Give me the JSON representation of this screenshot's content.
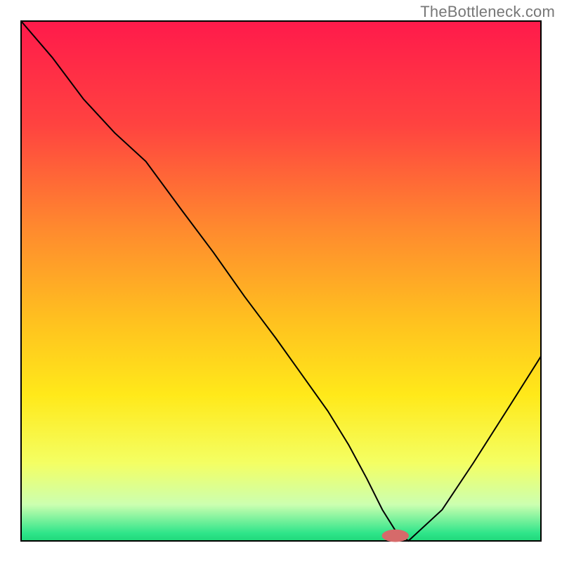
{
  "watermark": "TheBottleneck.com",
  "chart_data": {
    "type": "line",
    "title": "",
    "xlabel": "",
    "ylabel": "",
    "xlim": [
      0,
      1
    ],
    "ylim": [
      0,
      1
    ],
    "grid": false,
    "legend": false,
    "background_gradient_stops": [
      {
        "offset": 0.0,
        "color": "#ff1a4b"
      },
      {
        "offset": 0.2,
        "color": "#ff4340"
      },
      {
        "offset": 0.4,
        "color": "#ff8a2e"
      },
      {
        "offset": 0.58,
        "color": "#ffc21f"
      },
      {
        "offset": 0.72,
        "color": "#ffe91a"
      },
      {
        "offset": 0.85,
        "color": "#f4ff63"
      },
      {
        "offset": 0.93,
        "color": "#ccffb0"
      },
      {
        "offset": 0.985,
        "color": "#2fe58a"
      },
      {
        "offset": 1.0,
        "color": "#1fd87a"
      }
    ],
    "series": [
      {
        "name": "bottleneck-curve",
        "color": "#000000",
        "stroke_width": 2,
        "x": [
          0.0,
          0.06,
          0.12,
          0.18,
          0.24,
          0.31,
          0.37,
          0.43,
          0.49,
          0.54,
          0.59,
          0.63,
          0.665,
          0.695,
          0.72,
          0.745,
          0.81,
          0.87,
          0.94,
          1.0
        ],
        "y": [
          1.0,
          0.93,
          0.85,
          0.785,
          0.73,
          0.635,
          0.555,
          0.47,
          0.39,
          0.32,
          0.25,
          0.185,
          0.12,
          0.06,
          0.02,
          0.0,
          0.06,
          0.15,
          0.26,
          0.355
        ]
      }
    ],
    "flat_segment": {
      "x0": 0.695,
      "x1": 0.745,
      "y": 0.0
    },
    "marker": {
      "x": 0.72,
      "y": 0.01,
      "rx": 0.026,
      "ry": 0.012,
      "color": "#d66a6a"
    }
  }
}
